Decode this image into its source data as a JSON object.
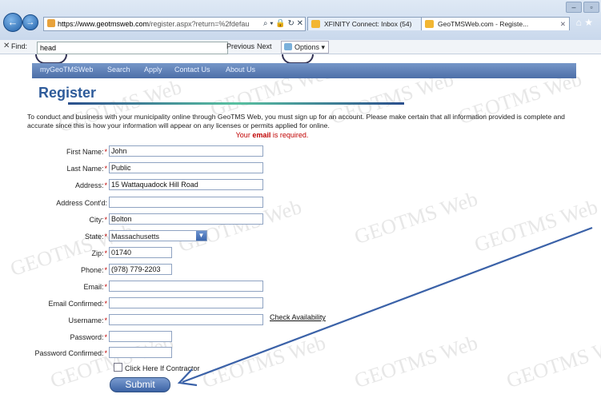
{
  "browser": {
    "address": {
      "host": "https://www.geotmsweb.com",
      "rest": "/register.aspx?return=%2fdefau"
    },
    "tabs": [
      {
        "title": "XFINITY Connect: Inbox (54)"
      },
      {
        "title": "GeoTMSWeb.com - Registe..."
      }
    ]
  },
  "findbar": {
    "label": "Find:",
    "value": "head",
    "previous": "Previous",
    "next": "Next",
    "options": "Options ▾"
  },
  "site_menu": [
    "myGeoTMSWeb",
    "Search",
    "Apply",
    "Contact Us",
    "About Us"
  ],
  "page": {
    "title": "Register",
    "intro": "To conduct and business with your municipality online through GeoTMS Web, you must sign up for an account. Please make certain that all information provided is complete and accurate since this is how your information will appear on any licenses or permits applied for online.",
    "required_pre": "Your ",
    "required_bold": "email",
    "required_post": " is required."
  },
  "form": {
    "first_name": {
      "label": "First Name:",
      "value": "John"
    },
    "last_name": {
      "label": "Last Name:",
      "value": "Public"
    },
    "address": {
      "label": "Address:",
      "value": "15 Wattaquadock Hill Road"
    },
    "address2": {
      "label": "Address Cont'd:",
      "value": ""
    },
    "city": {
      "label": "City:",
      "value": "Bolton"
    },
    "state": {
      "label": "State:",
      "value": "Massachusetts"
    },
    "zip": {
      "label": "Zip:",
      "value": "01740"
    },
    "phone": {
      "label": "Phone:",
      "value": "(978) 779-2203"
    },
    "email": {
      "label": "Email:",
      "value": ""
    },
    "email_confirmed": {
      "label": "Email Confirmed:",
      "value": ""
    },
    "username": {
      "label": "Username:",
      "value": ""
    },
    "password": {
      "label": "Password:",
      "value": ""
    },
    "password_confirmed": {
      "label": "Password Confirmed:",
      "value": ""
    },
    "check_availability": "Check Availability",
    "contractor_label": "Click Here If Contractor",
    "submit": "Submit"
  },
  "watermark": "GEOTMS Web",
  "colors": {
    "menu": "#4d6fa8",
    "title": "#2e5b9a",
    "required": "#c00000",
    "annotation": "#3b62a8"
  }
}
